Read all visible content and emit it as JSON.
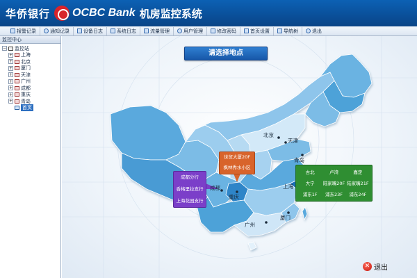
{
  "header": {
    "brand_cn": "华侨银行",
    "brand_en": "OCBC Bank",
    "system_title": "机房监控系统"
  },
  "toolbar": {
    "items": [
      {
        "label": "报警记录",
        "icon": "alarm-log-icon"
      },
      {
        "label": "通知记录",
        "icon": "notice-log-icon"
      },
      {
        "label": "设备日志",
        "icon": "device-log-icon"
      },
      {
        "label": "系统日志",
        "icon": "system-log-icon"
      },
      {
        "label": "流量管理",
        "icon": "traffic-icon"
      },
      {
        "label": "用户管理",
        "icon": "users-icon"
      },
      {
        "label": "修改密码",
        "icon": "password-icon"
      },
      {
        "label": "首页设置",
        "icon": "home-settings-icon"
      },
      {
        "label": "导航树",
        "icon": "nav-tree-icon"
      },
      {
        "label": "退出",
        "icon": "exit-icon"
      }
    ]
  },
  "sidebar": {
    "title": "监控中心",
    "root": "监控站",
    "children": [
      "上海",
      "北京",
      "厦门",
      "天津",
      "广州",
      "成都",
      "重庆",
      "青岛",
      "首页"
    ],
    "selected": "首页"
  },
  "main": {
    "title": "请选择地点",
    "cities": {
      "beijing": "北京",
      "tianjin": "天津",
      "qingdao": "青岛",
      "shanghai": "上海",
      "chengdu": "成都",
      "chongqing": "重庆",
      "xiamen": "厦门",
      "guangzhou": "广州"
    },
    "popup_chengdu": [
      "成都分行",
      "香格里拉支行",
      "上海花园支行"
    ],
    "popup_chongqing": [
      "世贸大厦20F",
      "枫林秀水小区"
    ],
    "popup_shanghai": [
      "古北",
      "卢湾",
      "嘉定",
      "大宁",
      "陆家嘴20F",
      "陆家嘴21F",
      "浦东1F",
      "浦东23F",
      "浦东24F"
    ],
    "exit_label": "退出"
  },
  "colors": {
    "header_blue": "#0a4f99",
    "map_blue": "#4aa0d8",
    "map_light": "#8fc6ea",
    "popup_purple": "#7b3fc9",
    "popup_orange": "#d8642b",
    "popup_green": "#2f8e32",
    "exit_red": "#c3150c"
  }
}
